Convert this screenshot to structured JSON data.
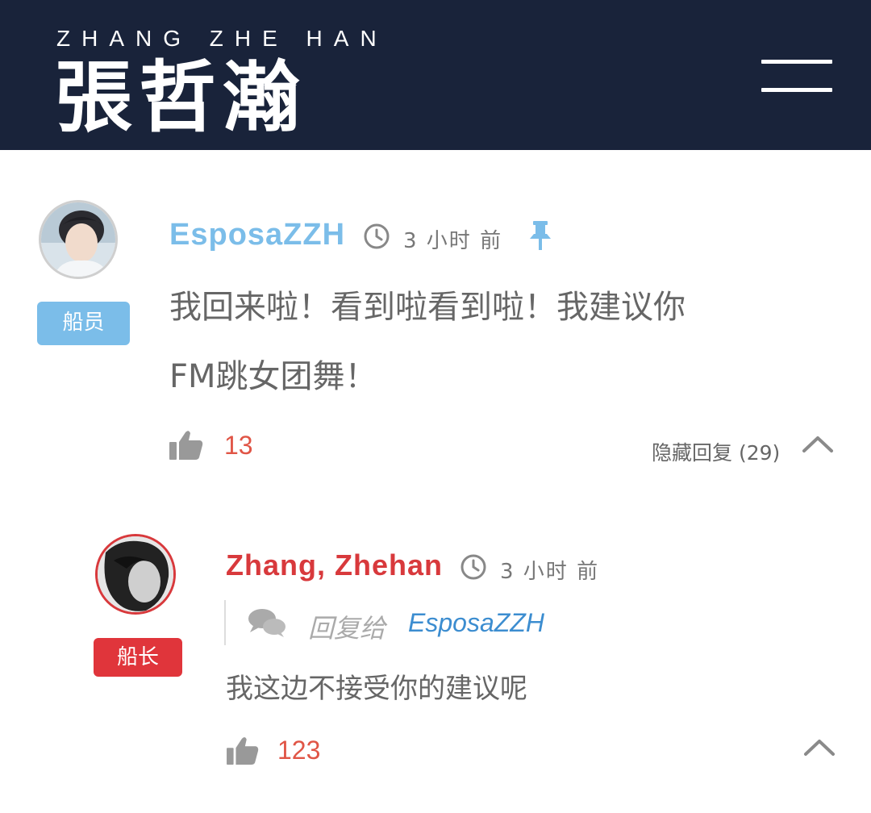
{
  "header": {
    "brand_latin": "ZHANG ZHE HAN",
    "brand_cjk": "張哲瀚",
    "menu_icon": "hamburger-icon"
  },
  "colors": {
    "header_bg": "#19233a",
    "crew_blue": "#7bbde9",
    "captain_red": "#e0353b",
    "like_red": "#e05546",
    "link_blue": "#3c8dd0"
  },
  "comment": {
    "username": "EsposaZZH",
    "badge": "船员",
    "time": "3 小时 前",
    "pinned_icon": "pin-icon",
    "text_line1": "我回来啦！看到啦看到啦！我建议你",
    "text_line2": "FM跳女团舞！",
    "likes": "13",
    "toggle_replies": "隐藏回复 (29)"
  },
  "reply": {
    "username": "Zhang, Zhehan",
    "badge": "船长",
    "time": "3 小时 前",
    "reply_to_label": "回复给",
    "reply_to_user": "EsposaZZH",
    "text": "我这边不接受你的建议呢",
    "likes": "123"
  }
}
